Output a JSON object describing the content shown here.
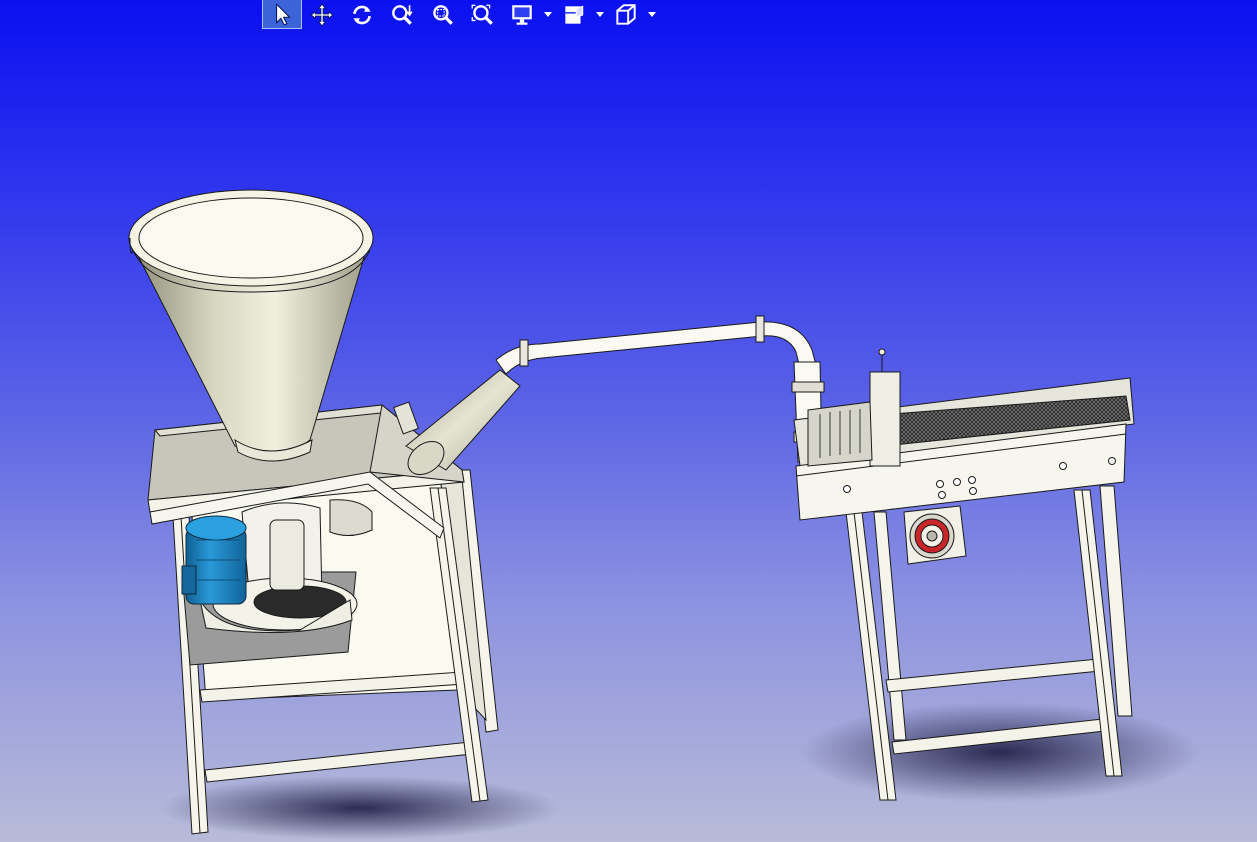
{
  "window": {
    "viewport_background_top": "#0a10f0",
    "viewport_background_bottom": "#b8bbd8"
  },
  "toolbar": {
    "tools": [
      {
        "id": "select",
        "icon": "select-arrow-icon",
        "active": true
      },
      {
        "id": "pan",
        "icon": "pan-icon",
        "active": false
      },
      {
        "id": "rotate",
        "icon": "rotate-icon",
        "active": false
      },
      {
        "id": "zoom-in-out",
        "icon": "zoom-in-out-icon",
        "active": false
      },
      {
        "id": "zoom-box",
        "icon": "zoom-box-icon",
        "active": false
      },
      {
        "id": "zoom-fit",
        "icon": "zoom-fit-icon",
        "active": false
      },
      {
        "id": "display-mode",
        "icon": "monitor-icon",
        "dropdown": true
      },
      {
        "id": "section",
        "icon": "section-view-icon",
        "dropdown": true
      },
      {
        "id": "view-orientation",
        "icon": "view-cube-icon",
        "dropdown": true
      }
    ]
  },
  "model": {
    "parts": [
      "hopper",
      "cabinet-frame",
      "electric-motor",
      "pump",
      "conveying-pipe",
      "outlet-cone",
      "filling-manifold",
      "conveyor-table",
      "bearing-unit"
    ],
    "colors": {
      "steel": "#f4f3ea",
      "hopper_light": "#ecebd8",
      "hopper_dark": "#8d8c78",
      "motor_blue": "#1b84c6",
      "bearing_red": "#c8262a"
    }
  }
}
